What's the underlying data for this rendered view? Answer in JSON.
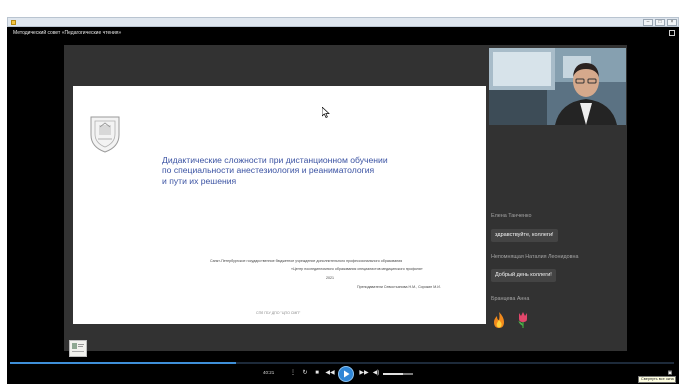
{
  "window": {
    "title": "Методический совет «Педагогические чтения»"
  },
  "slide": {
    "title_lines": [
      "Дидактические сложности при дистанционном обучении",
      "по специальности анестезиология и реаниматология",
      "и пути их решения"
    ],
    "org_line1": "Санкт-Петербургское государственное бюджетное учреждение дополнительного профессионального образования",
    "org_line2": "«Центр последипломного образования специалистов медицинского профиля»",
    "year": "2021",
    "authors": "Преподаватели Севостьянова Н.М., Сорокин М.И.",
    "footer": "СПб ГБУ ДПО \"ЦПО СМП\""
  },
  "chat": {
    "messages": [
      {
        "name": "Елена Танченко",
        "text": "здравствуйте, коллеги!"
      },
      {
        "name": "Непомнящая Наталия Леонидовна",
        "text": "Добрый день коллеги!"
      },
      {
        "name": "Бранцева Анна",
        "emoji": [
          "🔥",
          "🌷"
        ]
      }
    ]
  },
  "player": {
    "time": "40:21",
    "progress": 0.34,
    "volume": 0.65
  },
  "tooltip": {
    "text": "Свернуть все окна"
  },
  "colors": {
    "accent": "#2f86d6",
    "slide_title": "#3b53a3"
  }
}
